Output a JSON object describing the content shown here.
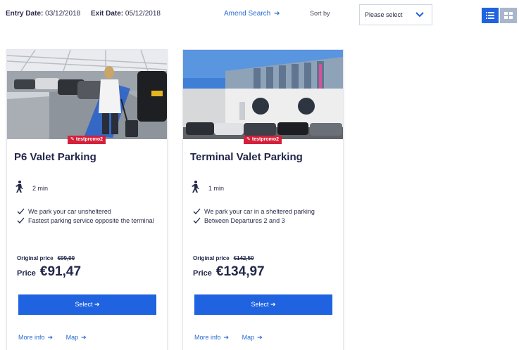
{
  "search": {
    "entry_label": "Entry Date:",
    "entry_value": "03/12/2018",
    "exit_label": "Exit Date:",
    "exit_value": "05/12/2018",
    "amend_label": "Amend Search",
    "sort_label": "Sort by",
    "sort_selected": "Please select"
  },
  "view_toggle": {
    "active": "list",
    "accent": "#1f63e0",
    "inactive": "#a9b6cb"
  },
  "cards": [
    {
      "badge": "testpromo2",
      "title": "P6 Valet Parking",
      "walk_time": "2 min",
      "features": [
        "We park your car unsheltered",
        "Fastest parking service opposite the terminal"
      ],
      "original_label": "Original price",
      "original_price": "€99,00",
      "price_label": "Price",
      "price": "€91,47",
      "select_label": "Select",
      "more_info": "More info",
      "map": "Map"
    },
    {
      "badge": "testpromo2",
      "title": "Terminal Valet Parking",
      "walk_time": "1 min",
      "features": [
        "We park your car in a sheltered parking",
        "Between Departures 2 and 3"
      ],
      "original_label": "Original price",
      "original_price": "€142,50",
      "price_label": "Price",
      "price": "€134,97",
      "select_label": "Select",
      "more_info": "More info",
      "map": "Map"
    }
  ],
  "colors": {
    "primary": "#1f63e0",
    "promo": "#d4213b",
    "link": "#2a6bd4",
    "text": "#22274a"
  }
}
